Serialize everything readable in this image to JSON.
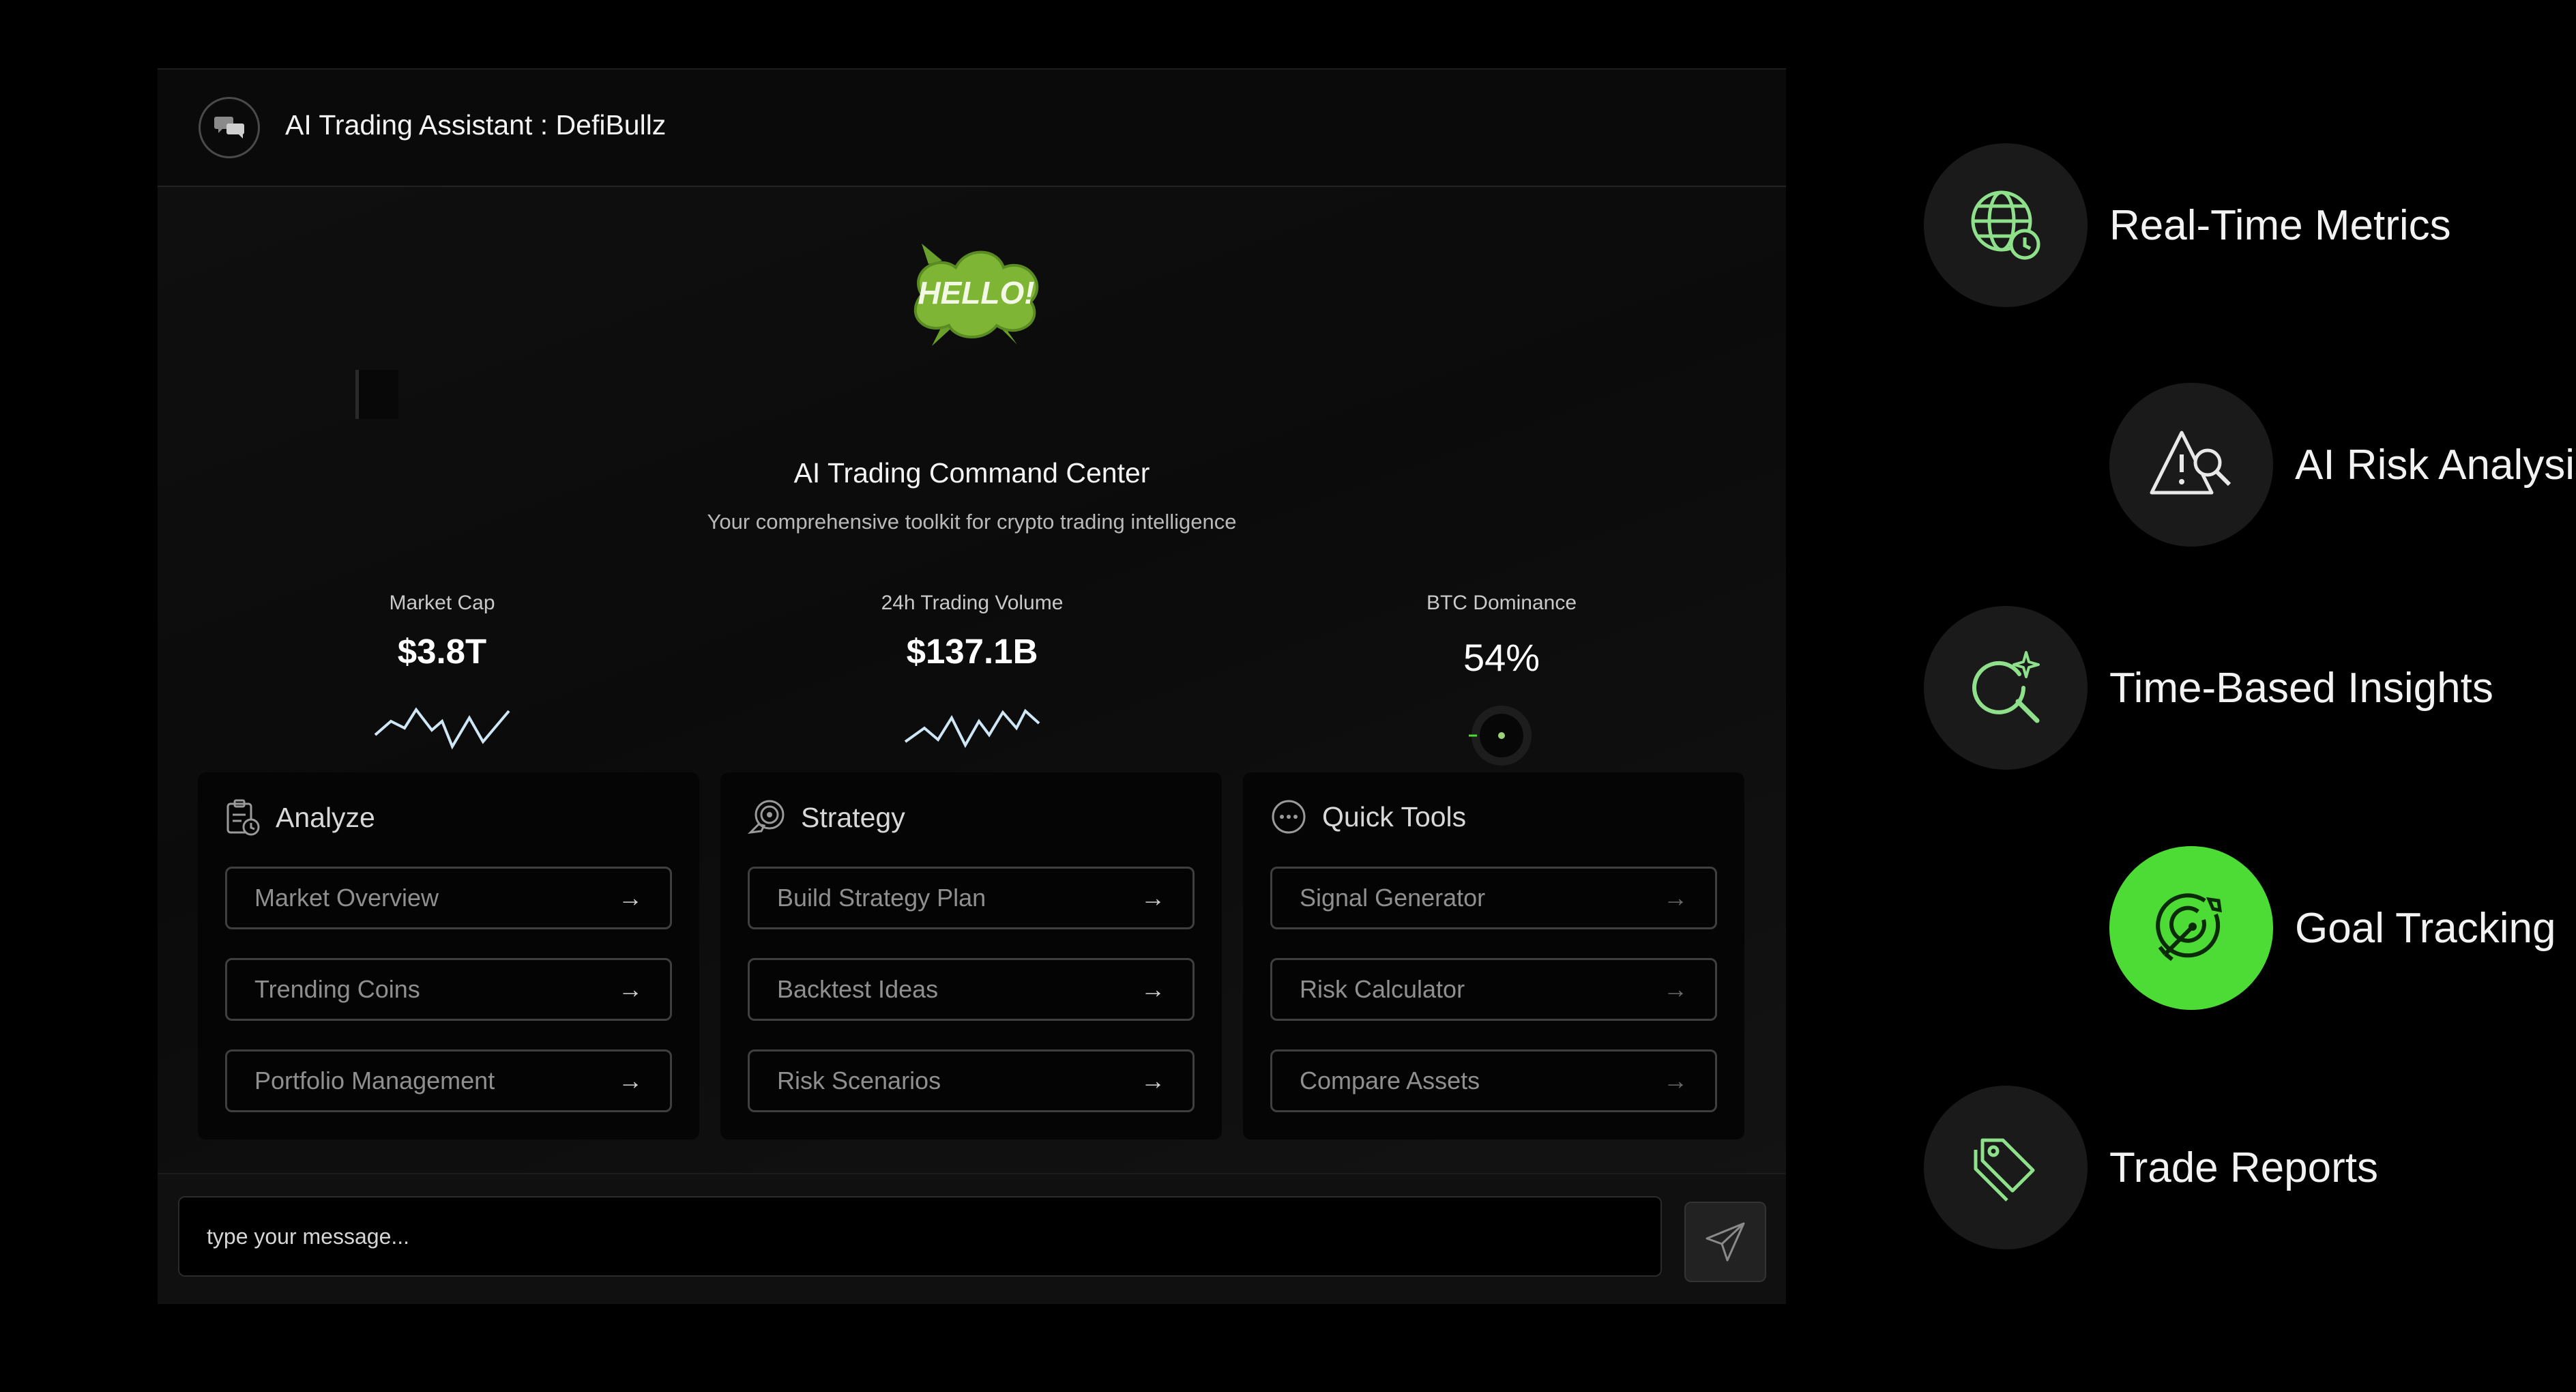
{
  "header": {
    "title": "AI Trading Assistant : DefiBullz",
    "icon": "chat-bubbles-icon"
  },
  "hero": {
    "badge_text": "HELLO!",
    "title": "AI Trading Command Center",
    "subtitle": "Your comprehensive toolkit for crypto trading intelligence"
  },
  "metrics": [
    {
      "label": "Market Cap",
      "value": "$3.8T",
      "visual": "sparkline"
    },
    {
      "label": "24h Trading Volume",
      "value": "$137.1B",
      "visual": "sparkline"
    },
    {
      "label": "BTC Dominance",
      "value": "54%",
      "visual": "gauge"
    }
  ],
  "cards": [
    {
      "title": "Analyze",
      "icon": "clipboard-clock-icon",
      "buttons": [
        "Market Overview",
        "Trending Coins",
        "Portfolio Management"
      ]
    },
    {
      "title": "Strategy",
      "icon": "target-hand-icon",
      "buttons": [
        "Build Strategy Plan",
        "Backtest Ideas",
        "Risk Scenarios"
      ]
    },
    {
      "title": "Quick Tools",
      "icon": "dots-circle-icon",
      "buttons": [
        "Signal Generator",
        "Risk Calculator",
        "Compare Assets"
      ]
    }
  ],
  "button_arrow": "→",
  "input": {
    "placeholder": "type your message..."
  },
  "features": [
    {
      "label": "Real-Time Metrics",
      "icon": "globe-clock-icon",
      "active": false
    },
    {
      "label": "AI Risk Analysis",
      "icon": "warning-search-icon",
      "active": false
    },
    {
      "label": "Time-Based Insights",
      "icon": "search-sparkle-icon",
      "active": false
    },
    {
      "label": "Goal Tracking",
      "icon": "target-arrow-icon",
      "active": true
    },
    {
      "label": "Trade Reports",
      "icon": "tags-icon",
      "active": false
    }
  ],
  "colors": {
    "accent": "#4ddb35",
    "icon_green": "#8fe08a",
    "sparkline": "#cfe6f5"
  }
}
